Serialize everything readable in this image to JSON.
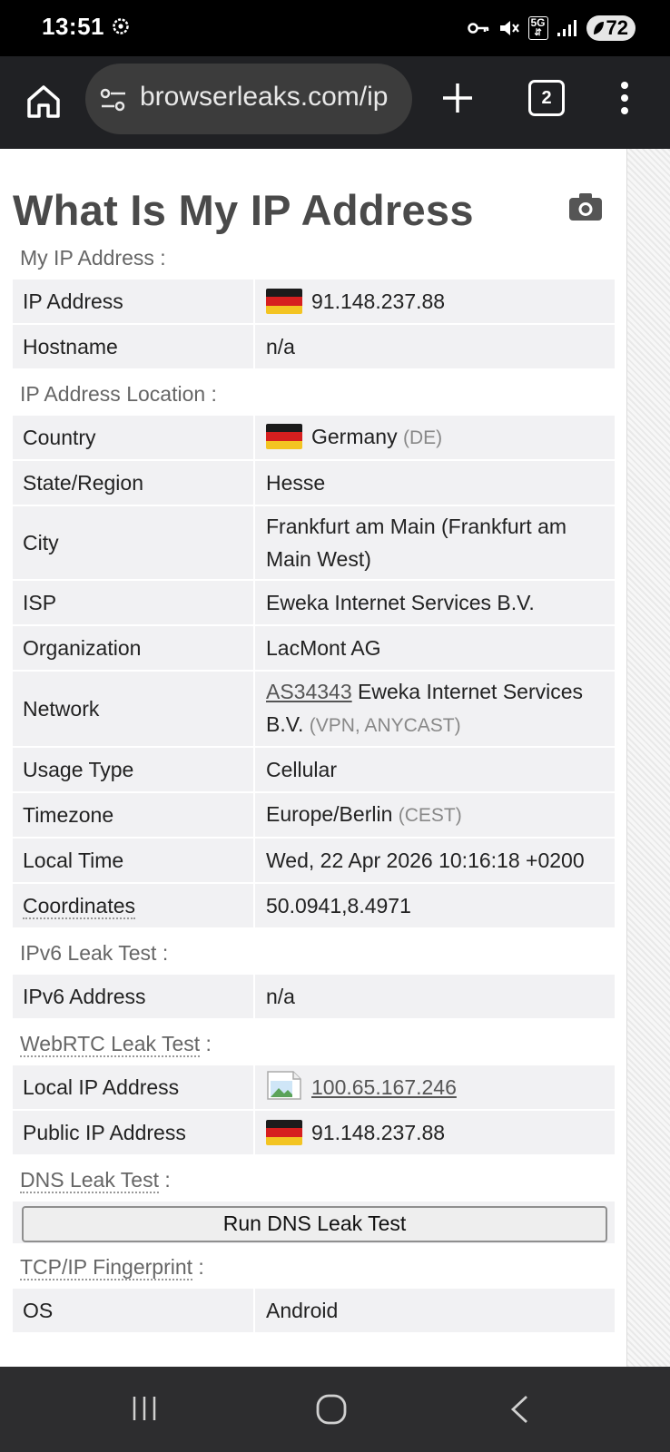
{
  "status_bar": {
    "time": "13:51",
    "network": "5G",
    "battery": "72"
  },
  "browser": {
    "url": "browserleaks.com/ip",
    "tab_count": "2"
  },
  "page": {
    "title": "What Is My IP Address"
  },
  "sections": {
    "my_ip": {
      "title": "My IP Address :",
      "rows": {
        "ip_address": {
          "label": "IP Address",
          "value": "91.148.237.88"
        },
        "hostname": {
          "label": "Hostname",
          "value": "n/a"
        }
      }
    },
    "location": {
      "title": "IP Address Location :",
      "rows": {
        "country": {
          "label": "Country",
          "value": "Germany",
          "code": "(DE)"
        },
        "state": {
          "label": "State/Region",
          "value": "Hesse"
        },
        "city": {
          "label": "City",
          "value": "Frankfurt am Main (Frankfurt am Main West)"
        },
        "isp": {
          "label": "ISP",
          "value": "Eweka Internet Services B.V."
        },
        "organization": {
          "label": "Organization",
          "value": "LacMont AG"
        },
        "network": {
          "label": "Network",
          "asn": "AS34343",
          "value": "Eweka Internet Services B.V.",
          "tags": "(VPN, ANYCAST)"
        },
        "usage_type": {
          "label": "Usage Type",
          "value": "Cellular"
        },
        "timezone": {
          "label": "Timezone",
          "value": "Europe/Berlin",
          "abbr": "(CEST)"
        },
        "local_time": {
          "label": "Local Time",
          "value": "Wed, 22 Apr 2026 10:16:18 +0200"
        },
        "coordinates": {
          "label": "Coordinates",
          "value": "50.0941,8.4971"
        }
      }
    },
    "ipv6": {
      "title": "IPv6 Leak Test :",
      "rows": {
        "ipv6_address": {
          "label": "IPv6 Address",
          "value": "n/a"
        }
      }
    },
    "webrtc": {
      "title": "WebRTC Leak Test",
      "rows": {
        "local_ip": {
          "label": "Local IP Address",
          "value": "100.65.167.246"
        },
        "public_ip": {
          "label": "Public IP Address",
          "value": "91.148.237.88"
        }
      }
    },
    "dns": {
      "title": "DNS Leak Test",
      "button_label": "Run DNS Leak Test"
    },
    "tcpip": {
      "title": "TCP/IP Fingerprint",
      "rows": {
        "os": {
          "label": "OS",
          "value": "Android"
        }
      }
    }
  },
  "colors": {
    "flag_black": "#1b1b1b",
    "flag_red": "#d61f1f",
    "flag_gold": "#f3c422",
    "row_bg": "#f1f1f3",
    "chrome_bg": "#202124"
  }
}
